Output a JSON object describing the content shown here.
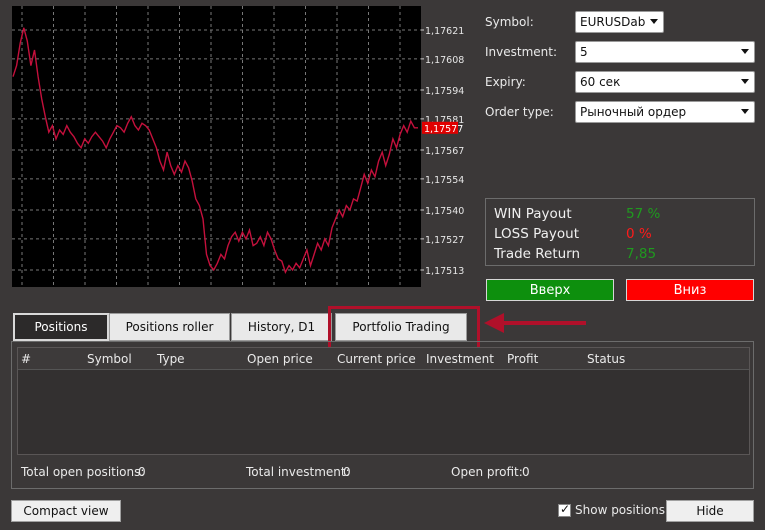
{
  "chart": {
    "price_labels": [
      "1,17621",
      "1,17608",
      "1,17594",
      "1,17581",
      "1,17567",
      "1,17554",
      "1,17540",
      "1,17527",
      "1,17513"
    ],
    "current_price": "1,17577",
    "line_color": "#c4103c",
    "current_price_bg": "#e00000",
    "series": [
      1.176,
      1.17605,
      1.17615,
      1.17622,
      1.17616,
      1.17605,
      1.17612,
      1.176,
      1.1759,
      1.17582,
      1.17575,
      1.17578,
      1.17572,
      1.17576,
      1.17574,
      1.17578,
      1.17575,
      1.17573,
      1.1757,
      1.17568,
      1.17572,
      1.1757,
      1.17573,
      1.17575,
      1.17573,
      1.17571,
      1.17568,
      1.17572,
      1.17575,
      1.17578,
      1.17577,
      1.17575,
      1.17579,
      1.17582,
      1.17578,
      1.17576,
      1.17579,
      1.17578,
      1.17576,
      1.17572,
      1.17568,
      1.17562,
      1.17558,
      1.17566,
      1.1756,
      1.17556,
      1.1756,
      1.17557,
      1.17562,
      1.17559,
      1.17553,
      1.17545,
      1.17542,
      1.17536,
      1.1752,
      1.17515,
      1.17513,
      1.17516,
      1.1752,
      1.17518,
      1.17524,
      1.17528,
      1.1753,
      1.17526,
      1.1753,
      1.17527,
      1.17531,
      1.17524,
      1.17525,
      1.17528,
      1.17524,
      1.1753,
      1.17527,
      1.17522,
      1.17518,
      1.17517,
      1.17512,
      1.17515,
      1.17513,
      1.17516,
      1.17514,
      1.17518,
      1.17522,
      1.17515,
      1.1752,
      1.17525,
      1.17522,
      1.17527,
      1.17524,
      1.17532,
      1.17536,
      1.1754,
      1.17537,
      1.17542,
      1.1754,
      1.17545,
      1.17544,
      1.1755,
      1.17556,
      1.17552,
      1.17558,
      1.17555,
      1.17562,
      1.17566,
      1.1756,
      1.17565,
      1.17572,
      1.17568,
      1.17574,
      1.17578,
      1.17575,
      1.1758,
      1.17577,
      1.17577
    ]
  },
  "form": {
    "symbol_label": "Symbol:",
    "symbol_value": "EURUSDab",
    "investment_label": "Investment:",
    "investment_value": "5",
    "expiry_label": "Expiry:",
    "expiry_value": "60 сек",
    "order_type_label": "Order type:",
    "order_type_value": "Рыночный ордер"
  },
  "payout": {
    "win_label": "WIN Payout",
    "win_value": "57 %",
    "win_color": "#1f9a1f",
    "loss_label": "LOSS Payout",
    "loss_value": "0 %",
    "loss_color": "#ff1a1a",
    "return_label": "Trade Return",
    "return_value": "7,85",
    "return_color": "#1f9a1f"
  },
  "buttons": {
    "up_label": "Вверх",
    "up_color": "#0d8f0d",
    "down_label": "Вниз",
    "down_color": "#ff0000",
    "compact_label": "Compact view",
    "hide_label": "Hide",
    "show_positions_label": "Show positions",
    "show_positions_checked": true
  },
  "tabs": [
    {
      "label": "Positions",
      "active": true
    },
    {
      "label": "Positions roller",
      "active": false
    },
    {
      "label": "History, D1",
      "active": false
    },
    {
      "label": "Portfolio Trading",
      "active": false
    }
  ],
  "annotation": {
    "highlight_color": "#b0102a"
  },
  "table": {
    "columns": [
      "#",
      "Symbol",
      "Type",
      "Open price",
      "Current price",
      "Investment",
      "Profit",
      "Status"
    ]
  },
  "summary": {
    "open_positions_label": "Total open positions:",
    "open_positions_value": "0",
    "total_investment_label": "Total investment:",
    "total_investment_value": "0",
    "open_profit_label": "Open profit:",
    "open_profit_value": "0"
  }
}
